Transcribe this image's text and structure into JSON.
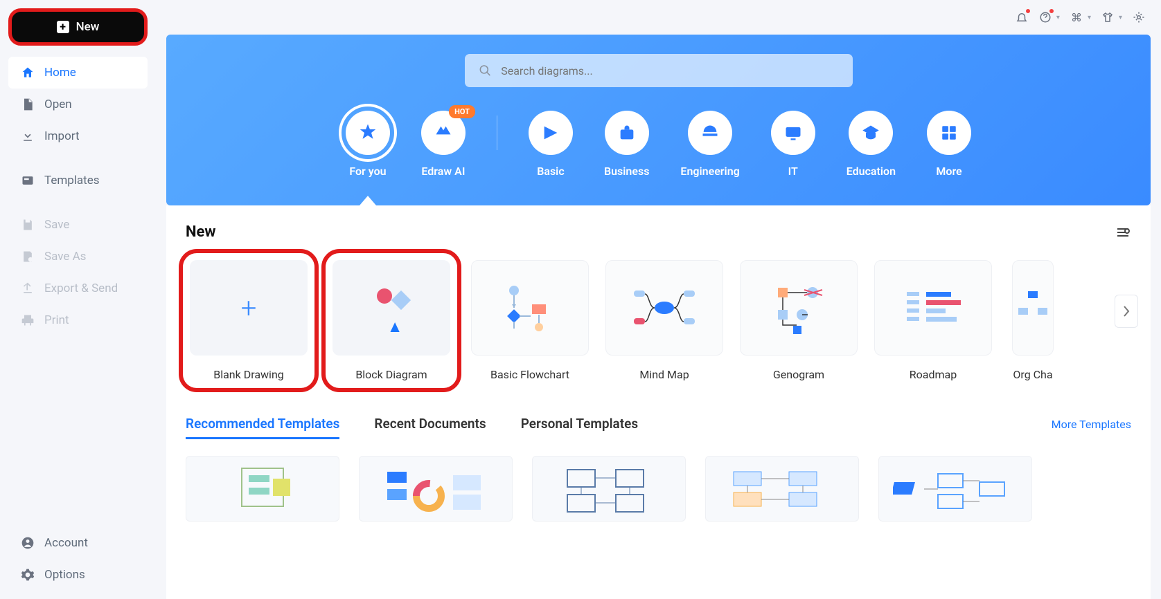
{
  "sidebar": {
    "new_label": "New",
    "items": [
      {
        "label": "Home",
        "icon": "home",
        "active": true
      },
      {
        "label": "Open",
        "icon": "file"
      },
      {
        "label": "Import",
        "icon": "import"
      }
    ],
    "templates_label": "Templates",
    "file_ops": [
      {
        "label": "Save",
        "icon": "save"
      },
      {
        "label": "Save As",
        "icon": "save-as"
      },
      {
        "label": "Export & Send",
        "icon": "export"
      },
      {
        "label": "Print",
        "icon": "print"
      }
    ],
    "bottom": [
      {
        "label": "Account",
        "icon": "account"
      },
      {
        "label": "Options",
        "icon": "gear"
      }
    ]
  },
  "search": {
    "placeholder": "Search diagrams..."
  },
  "categories": [
    {
      "label": "For you",
      "active": true
    },
    {
      "label": "Edraw AI",
      "hot": true
    },
    {
      "label": "Basic"
    },
    {
      "label": "Business"
    },
    {
      "label": "Engineering"
    },
    {
      "label": "IT"
    },
    {
      "label": "Education"
    },
    {
      "label": "More"
    }
  ],
  "hot_label": "HOT",
  "section_new": "New",
  "templates": [
    {
      "label": "Blank Drawing",
      "type": "blank",
      "highlighted": true
    },
    {
      "label": "Block Diagram",
      "type": "block",
      "highlighted": true
    },
    {
      "label": "Basic Flowchart",
      "type": "flowchart"
    },
    {
      "label": "Mind Map",
      "type": "mindmap"
    },
    {
      "label": "Genogram",
      "type": "genogram"
    },
    {
      "label": "Roadmap",
      "type": "roadmap"
    },
    {
      "label": "Org Cha",
      "type": "org"
    }
  ],
  "tabs": [
    {
      "label": "Recommended Templates",
      "active": true
    },
    {
      "label": "Recent Documents"
    },
    {
      "label": "Personal Templates"
    }
  ],
  "more_templates": "More Templates"
}
